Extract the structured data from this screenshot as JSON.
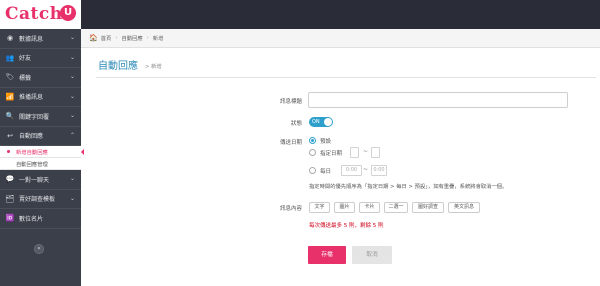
{
  "brand": {
    "name": "Catch",
    "badge": "U"
  },
  "sidebar": {
    "items": [
      {
        "label": "數據訊息",
        "icon": "dashboard-icon",
        "glyph": "◉",
        "chevron": "⌄"
      },
      {
        "label": "好友",
        "icon": "friends-icon",
        "glyph": "👥",
        "chevron": "⌄"
      },
      {
        "label": "標籤",
        "icon": "tag-icon",
        "glyph": "🏷",
        "chevron": "⌄"
      },
      {
        "label": "推播訊息",
        "icon": "broadcast-icon",
        "glyph": "📶",
        "chevron": "⌄"
      },
      {
        "label": "關鍵字回覆",
        "icon": "keyword-icon",
        "glyph": "🔍",
        "chevron": "⌄"
      },
      {
        "label": "自動回應",
        "icon": "reply-icon",
        "glyph": "↩",
        "chevron": "⌃"
      }
    ],
    "subitems": [
      {
        "label": "新增自動回應",
        "active": true
      },
      {
        "label": "自動回應管理",
        "active": false
      }
    ],
    "items_after": [
      {
        "label": "一對一聊天",
        "icon": "chat-icon",
        "glyph": "💬",
        "chevron": "⌄"
      },
      {
        "label": "賣好調查模板",
        "icon": "survey-icon",
        "glyph": "🗂",
        "chevron": "⌄"
      },
      {
        "label": "數位名片",
        "icon": "card-icon",
        "glyph": "🆔",
        "chevron": ""
      }
    ],
    "toggle_glyph": "«"
  },
  "breadcrumb": {
    "home": "首頁",
    "section": "自動回應",
    "current": "新增",
    "sep": "›"
  },
  "page": {
    "title": "自動回應",
    "subtitle": "> 新增"
  },
  "form": {
    "title_label": "訊息標題",
    "title_value": "",
    "status_label": "狀態",
    "status_toggle": "ON",
    "date_label": "傳送日期",
    "opt_default": "預設",
    "opt_range": "指定日期",
    "opt_daily": "每日",
    "time_from": "0:00",
    "time_to": "0:00",
    "tilde": "~",
    "hint": "指定時間的優先順序為「指定日期 > 每日 > 預設」，如有重疊，系統將會取消一個。",
    "content_label": "訊息內容",
    "insert_buttons": [
      "文字",
      "圖片",
      "卡片",
      "二選一",
      "圖好調查",
      "英文訊息"
    ],
    "limit_text": "每次傳送最多 5 則，剩餘 5 則",
    "save": "存檔",
    "cancel": "取消"
  },
  "colors": {
    "brand": "#e8306a",
    "accent": "#2fa0cc",
    "sidebar": "#3b3f4a",
    "header": "#2a2d37"
  }
}
